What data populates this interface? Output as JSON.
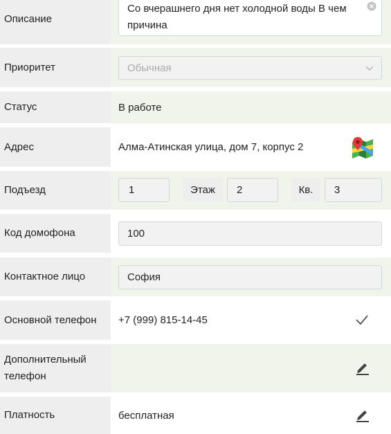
{
  "description": {
    "label": "Описание",
    "value": "Со вчерашнего дня нет холодной воды В чем причина"
  },
  "priority": {
    "label": "Приоритет",
    "placeholder": "Обычная"
  },
  "status": {
    "label": "Статус",
    "value": "В работе"
  },
  "address": {
    "label": "Адрес",
    "value": "Алма-Атинская улица, дом 7, корпус 2"
  },
  "entrance": {
    "label": "Подъезд",
    "value": "1",
    "floor_label": "Этаж",
    "floor_value": "2",
    "apt_label": "Кв.",
    "apt_value": "3"
  },
  "intercom": {
    "label": "Код домофона",
    "value": "100"
  },
  "contact": {
    "label": "Контактное лицо",
    "value": "София"
  },
  "main_phone": {
    "label": "Основной телефон",
    "value": "+7 (999) 815-14-45"
  },
  "extra_phone": {
    "label": "Дополнительный телефон"
  },
  "payment": {
    "label": "Платность",
    "value": "бесплатная"
  },
  "colors": {
    "row_green": "#f1f4eb",
    "label_bg": "#eeeeee",
    "field_bg": "#f2f2f2"
  },
  "icons": [
    "clear-icon",
    "chevron-down-icon",
    "map-icon",
    "check-icon",
    "edit-icon"
  ]
}
